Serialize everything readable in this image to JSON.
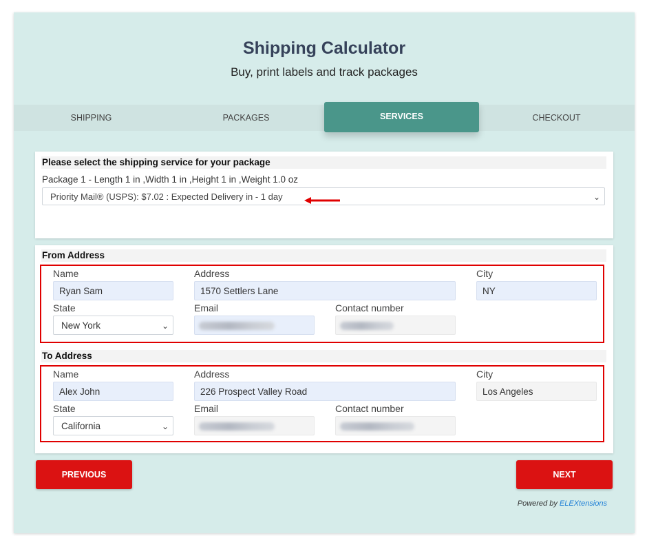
{
  "header": {
    "title": "Shipping Calculator",
    "subtitle": "Buy, print labels and track packages"
  },
  "tabs": [
    {
      "label": "SHIPPING",
      "active": false
    },
    {
      "label": "PACKAGES",
      "active": false
    },
    {
      "label": "SERVICES",
      "active": true
    },
    {
      "label": "CHECKOUT",
      "active": false
    }
  ],
  "service": {
    "heading": "Please select the shipping service for your package",
    "package_info": "Package 1 - Length 1 in ,Width 1 in ,Height 1 in ,Weight 1.0 oz",
    "selected_service": "Priority Mail® (USPS): $7.02 : Expected Delivery in - 1 day"
  },
  "from_address": {
    "heading": "From Address",
    "labels": {
      "name": "Name",
      "address": "Address",
      "city": "City",
      "state": "State",
      "email": "Email",
      "contact": "Contact number"
    },
    "name": "Ryan Sam",
    "address": "1570 Settlers Lane",
    "city": "NY",
    "state": "New York",
    "email": "",
    "contact": ""
  },
  "to_address": {
    "heading": "To Address",
    "labels": {
      "name": "Name",
      "address": "Address",
      "city": "City",
      "state": "State",
      "email": "Email",
      "contact": "Contact number"
    },
    "name": "Alex John",
    "address": "226 Prospect Valley Road",
    "city": "Los Angeles",
    "state": "California",
    "email": "",
    "contact": ""
  },
  "buttons": {
    "previous": "PREVIOUS",
    "next": "NEXT"
  },
  "footer": {
    "powered_by": "Powered by",
    "brand": "ELEXtensions"
  },
  "colors": {
    "accent": "#4a968a",
    "button": "#db1212",
    "highlight": "#e00000",
    "background": "#d6ecea"
  }
}
